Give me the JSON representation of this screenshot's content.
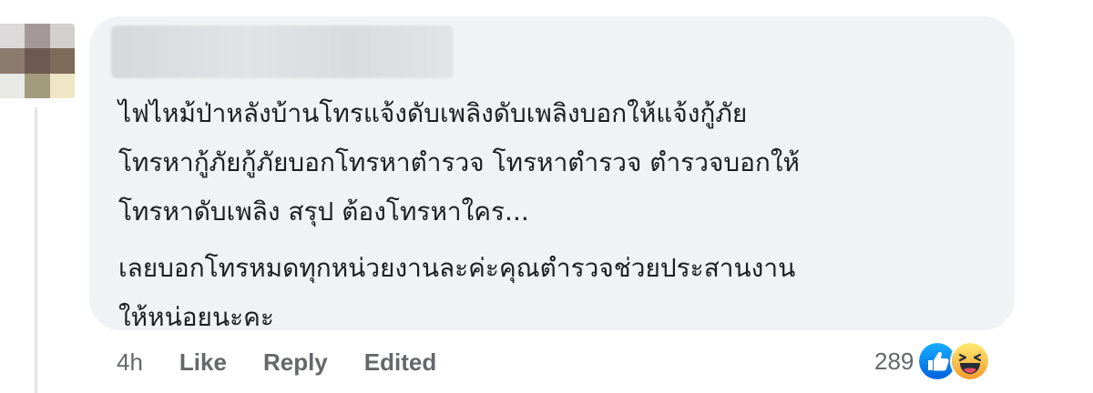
{
  "comment": {
    "paragraphs": [
      [
        "ไฟไหม้ป่าหลังบ้านโทรแจ้งดับเพลิงดับเพลิงบอกให้แจ้งกู้ภัย",
        "โทรหากู้ภัยกู้ภัยบอกโทรหาตำรวจ โทรหาตำรวจ ตำรวจบอกให้",
        "โทรหาดับเพลิง สรุป ต้องโทรหาใคร..."
      ],
      [
        "เลยบอกโทรหมดทุกหน่วยงานละค่ะคุณตำรวจช่วยประสานงาน",
        "ให้หน่อยนะคะ"
      ]
    ]
  },
  "actions": {
    "time": "4h",
    "like": "Like",
    "reply": "Reply",
    "edited": "Edited"
  },
  "reactions": {
    "count": "289",
    "icons": [
      "like-icon",
      "haha-icon"
    ],
    "colors": {
      "like": "#1877f2",
      "haha": "#f7b125"
    }
  },
  "colors": {
    "bubble": "#f0f2f5",
    "text": "#1c1e21",
    "meta": "#65676b",
    "thread_line": "#e4e6eb"
  }
}
